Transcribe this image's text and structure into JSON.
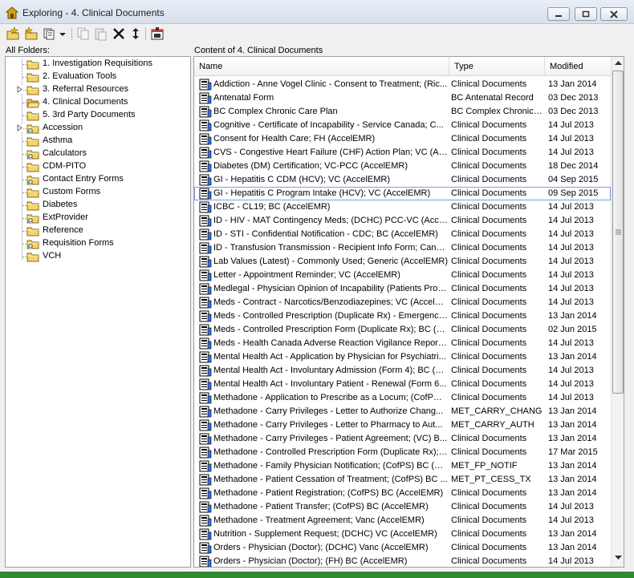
{
  "window": {
    "title": "Exploring - 4. Clinical Documents"
  },
  "toolbar": {
    "icons": [
      "new-folder-icon",
      "new-item-icon",
      "views-icon",
      "copy-icon",
      "paste-icon",
      "delete-icon",
      "refresh-icon",
      "properties-icon"
    ]
  },
  "folders_label": "All Folders:",
  "content_label": "Content of 4. Clinical Documents",
  "tree": [
    {
      "label": "1. Investigation Requisitions",
      "icon": "folder-icon"
    },
    {
      "label": "2. Evaluation Tools",
      "icon": "folder-icon"
    },
    {
      "label": "3. Referral Resources",
      "icon": "folder-icon"
    },
    {
      "label": "4. Clinical Documents",
      "icon": "open-folder-icon"
    },
    {
      "label": "5. 3rd Party Documents",
      "icon": "folder-icon"
    },
    {
      "label": "Accession",
      "icon": "shared-folder-icon"
    },
    {
      "label": "Asthma",
      "icon": "folder-icon"
    },
    {
      "label": "Calculators",
      "icon": "shared-folder-icon"
    },
    {
      "label": "CDM-PITO",
      "icon": "folder-icon"
    },
    {
      "label": "Contact Entry Forms",
      "icon": "shared-folder-icon"
    },
    {
      "label": "Custom Forms",
      "icon": "folder-icon"
    },
    {
      "label": "Diabetes",
      "icon": "folder-icon"
    },
    {
      "label": "ExtProvider",
      "icon": "shared-folder-icon"
    },
    {
      "label": "Reference",
      "icon": "folder-icon"
    },
    {
      "label": "Requisition Forms",
      "icon": "shared-folder-icon"
    },
    {
      "label": "VCH",
      "icon": "folder-icon"
    }
  ],
  "columns": {
    "name": "Name",
    "type": "Type",
    "modified": "Modified"
  },
  "rows": [
    {
      "name": "Addiction - Anne Vogel Clinic - Consent to Treatment; (Ric...",
      "type": "Clinical Documents",
      "modified": "13 Jan 2014"
    },
    {
      "name": "Antenatal Form",
      "type": "BC Antenatal Record",
      "modified": "03 Dec 2013"
    },
    {
      "name": "BC Complex Chronic Care Plan",
      "type": "BC Complex Chronic ...",
      "modified": "03 Dec 2013"
    },
    {
      "name": "Cognitive - Certificate of Incapability - Service Canada; C...",
      "type": "Clinical Documents",
      "modified": "14 Jul 2013"
    },
    {
      "name": "Consent for Health Care; FH (AccelEMR)",
      "type": "Clinical Documents",
      "modified": "14 Jul 2013"
    },
    {
      "name": "CVS - Congestive Heart Failure (CHF) Action Plan; VC (Acc...",
      "type": "Clinical Documents",
      "modified": "14 Jul 2013"
    },
    {
      "name": "Diabetes (DM) Certification; VC-PCC (AccelEMR)",
      "type": "Clinical Documents",
      "modified": "18 Dec 2014"
    },
    {
      "name": "GI - Hepatitis C CDM (HCV); VC (AccelEMR)",
      "type": "Clinical Documents",
      "modified": "04 Sep 2015"
    },
    {
      "name": "GI - Hepatitis C Program Intake (HCV); VC (AccelEMR)",
      "type": "Clinical Documents",
      "modified": "09 Sep 2015",
      "selected": true
    },
    {
      "name": "ICBC - CL19; BC (AccelEMR)",
      "type": "Clinical Documents",
      "modified": "14 Jul 2013"
    },
    {
      "name": "ID - HIV - MAT Contingency Meds; (DCHC) PCC-VC (Accel...",
      "type": "Clinical Documents",
      "modified": "14 Jul 2013"
    },
    {
      "name": "ID - STI - Confidential Notification - CDC; BC (AccelEMR)",
      "type": "Clinical Documents",
      "modified": "14 Jul 2013"
    },
    {
      "name": "ID - Transfusion Transmission - Recipient Info Form; Cana...",
      "type": "Clinical Documents",
      "modified": "14 Jul 2013"
    },
    {
      "name": "Lab Values (Latest) - Commonly Used; Generic (AccelEMR)",
      "type": "Clinical Documents",
      "modified": "14 Jul 2013"
    },
    {
      "name": "Letter - Appointment Reminder; VC (AccelEMR)",
      "type": "Clinical Documents",
      "modified": "14 Jul 2013"
    },
    {
      "name": "Medlegal - Physician Opinion of Incapability (Patients Prop...",
      "type": "Clinical Documents",
      "modified": "14 Jul 2013"
    },
    {
      "name": "Meds - Contract - Narcotics/Benzodiazepines; VC (AccelEMR)",
      "type": "Clinical Documents",
      "modified": "14 Jul 2013"
    },
    {
      "name": "Meds - Controlled Prescription (Duplicate Rx) - Emergency...",
      "type": "Clinical Documents",
      "modified": "13 Jan 2014"
    },
    {
      "name": "Meds - Controlled Prescription Form (Duplicate Rx); BC (A...",
      "type": "Clinical Documents",
      "modified": "02 Jun 2015"
    },
    {
      "name": "Meds - Health Canada Adverse Reaction Vigilance Report ...",
      "type": "Clinical Documents",
      "modified": "14 Jul 2013"
    },
    {
      "name": "Mental Health Act - Application by Physician for Psychiatri...",
      "type": "Clinical Documents",
      "modified": "13 Jan 2014"
    },
    {
      "name": "Mental Health Act - Involuntary Admission (Form 4); BC (A...",
      "type": "Clinical Documents",
      "modified": "14 Jul 2013"
    },
    {
      "name": "Mental Health Act - Involuntary Patient - Renewal (Form 6...",
      "type": "Clinical Documents",
      "modified": "14 Jul 2013"
    },
    {
      "name": "Methadone - Application to Prescribe as a Locum; (CofPS) ...",
      "type": "Clinical Documents",
      "modified": "14 Jul 2013"
    },
    {
      "name": "Methadone - Carry Privileges - Letter to Authorize Chang...",
      "type": "MET_CARRY_CHANG",
      "modified": "13 Jan 2014"
    },
    {
      "name": "Methadone - Carry Privileges - Letter to Pharmacy to Aut...",
      "type": "MET_CARRY_AUTH",
      "modified": "13 Jan 2014"
    },
    {
      "name": "Methadone - Carry Privileges - Patient Agreement; (VC) B...",
      "type": "Clinical Documents",
      "modified": "13 Jan 2014"
    },
    {
      "name": "Methadone - Controlled Prescription Form (Duplicate Rx); ...",
      "type": "Clinical Documents",
      "modified": "17 Mar 2015"
    },
    {
      "name": "Methadone - Family Physician Notification; (CofPS) BC (Ac...",
      "type": "MET_FP_NOTIF",
      "modified": "13 Jan 2014"
    },
    {
      "name": "Methadone - Patient Cessation of Treatment; (CofPS) BC ...",
      "type": "MET_PT_CESS_TX",
      "modified": "13 Jan 2014"
    },
    {
      "name": "Methadone - Patient Registration; (CofPS) BC (AccelEMR)",
      "type": "Clinical Documents",
      "modified": "13 Jan 2014"
    },
    {
      "name": "Methadone - Patient Transfer; (CofPS) BC (AccelEMR)",
      "type": "Clinical Documents",
      "modified": "14 Jul 2013"
    },
    {
      "name": "Methadone - Treatment Agreement; Vanc (AccelEMR)",
      "type": "Clinical Documents",
      "modified": "14 Jul 2013"
    },
    {
      "name": "Nutrition - Supplement Request; (DCHC) VC (AccelEMR)",
      "type": "Clinical Documents",
      "modified": "13 Jan 2014"
    },
    {
      "name": "Orders - Physician (Doctor); (DCHC) Vanc (AccelEMR)",
      "type": "Clinical Documents",
      "modified": "13 Jan 2014"
    },
    {
      "name": "Orders - Physician (Doctor); (FH) BC (AccelEMR)",
      "type": "Clinical Documents",
      "modified": "14 Jul 2013"
    }
  ]
}
